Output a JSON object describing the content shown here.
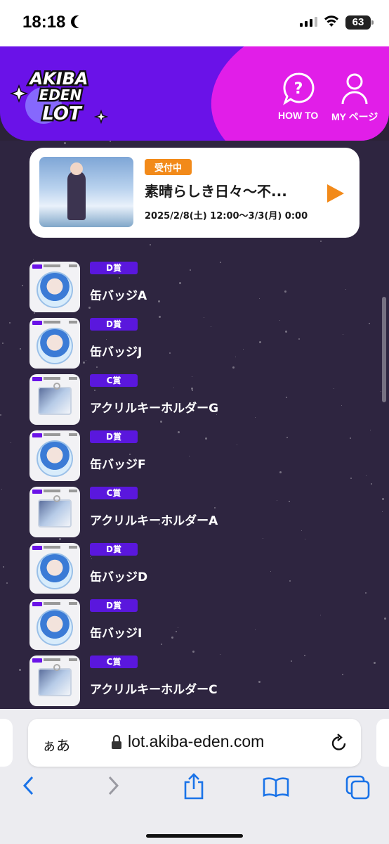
{
  "status": {
    "time": "18:18",
    "battery": "63"
  },
  "header": {
    "logo_lines": [
      "AKIBA",
      "EDEN",
      "LOT"
    ],
    "howto_label": "HOW TO",
    "mypage_label": "MY ページ"
  },
  "campaign": {
    "badge": "受付中",
    "title": "素晴らしき日々〜不...",
    "date": "2025/2/8(土) 12:00〜3/3(月) 0:00"
  },
  "items": [
    {
      "prize": "D賞",
      "name": "缶バッジA",
      "kind": "badge"
    },
    {
      "prize": "D賞",
      "name": "缶バッジJ",
      "kind": "badge"
    },
    {
      "prize": "C賞",
      "name": "アクリルキーホルダーG",
      "kind": "acrylic"
    },
    {
      "prize": "D賞",
      "name": "缶バッジF",
      "kind": "badge"
    },
    {
      "prize": "C賞",
      "name": "アクリルキーホルダーA",
      "kind": "acrylic"
    },
    {
      "prize": "D賞",
      "name": "缶バッジD",
      "kind": "badge"
    },
    {
      "prize": "D賞",
      "name": "缶バッジI",
      "kind": "badge"
    },
    {
      "prize": "C賞",
      "name": "アクリルキーホルダーC",
      "kind": "acrylic"
    }
  ],
  "browser": {
    "aa_label": "ぁあ",
    "url": "lot.akiba-eden.com"
  },
  "colors": {
    "purple": "#6a12e8",
    "pink": "#e11ee8",
    "orange": "#f28a1a",
    "background": "#2e2540",
    "safari_blue": "#1a73e8"
  }
}
